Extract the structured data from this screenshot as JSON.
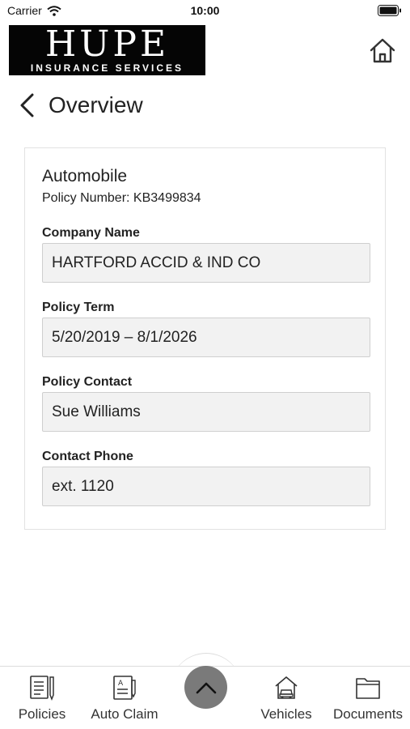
{
  "status_bar": {
    "carrier": "Carrier",
    "time": "10:00"
  },
  "header": {
    "logo_main": "HUPE",
    "logo_sub": "INSURANCE SERVICES",
    "home_icon": "home-icon"
  },
  "nav": {
    "title": "Overview",
    "back_icon": "chevron-left-icon"
  },
  "policy": {
    "type": "Automobile",
    "number_text": "Policy Number: KB3499834",
    "fields": [
      {
        "label": "Company Name",
        "value": "HARTFORD ACCID & IND CO"
      },
      {
        "label": "Policy Term",
        "value": "5/20/2019 – 8/1/2026"
      },
      {
        "label": "Policy Contact",
        "value": "Sue Williams"
      },
      {
        "label": "Contact Phone",
        "value": "ext. 1120"
      }
    ]
  },
  "tabbar": {
    "tabs": [
      {
        "label": "Policies",
        "icon": "policies-icon"
      },
      {
        "label": "Auto Claim",
        "icon": "auto-claim-icon"
      },
      {
        "label": "Vehicles",
        "icon": "vehicles-icon"
      },
      {
        "label": "Documents",
        "icon": "documents-icon"
      }
    ],
    "center_icon": "chevron-up-icon"
  },
  "colors": {
    "logo_bg": "#050505",
    "field_bg": "#f2f2f2",
    "center_button": "#7a7a7a"
  }
}
